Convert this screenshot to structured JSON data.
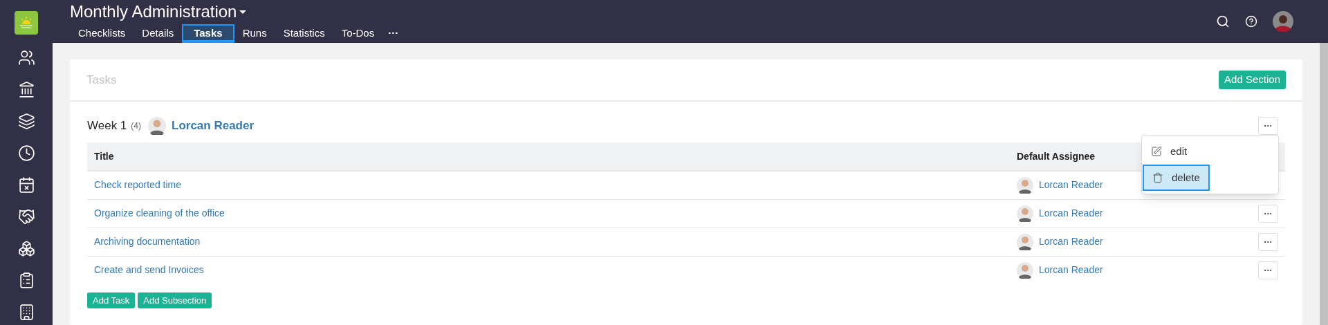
{
  "header": {
    "title": "Monthly Administration",
    "tabs": [
      {
        "label": "Checklists",
        "selected": false
      },
      {
        "label": "Details",
        "selected": false
      },
      {
        "label": "Tasks",
        "selected": true
      },
      {
        "label": "Runs",
        "selected": false
      },
      {
        "label": "Statistics",
        "selected": false
      },
      {
        "label": "To-Dos",
        "selected": false
      }
    ],
    "more": "···"
  },
  "panel": {
    "title": "Tasks",
    "add_section": "Add Section"
  },
  "section": {
    "name": "Week 1",
    "count": "(4)",
    "assignee": "Lorcan Reader",
    "menu_button": "···",
    "columns": [
      "Title",
      "Default Assignee"
    ],
    "rows": [
      {
        "title": "Check reported time",
        "assignee": "Lorcan Reader"
      },
      {
        "title": "Organize cleaning of the office",
        "assignee": "Lorcan Reader",
        "menu_button": "···"
      },
      {
        "title": "Archiving documentation",
        "assignee": "Lorcan Reader",
        "menu_button": "···"
      },
      {
        "title": "Create and send Invoices",
        "assignee": "Lorcan Reader",
        "menu_button": "···"
      }
    ],
    "buttons": [
      "Add Task",
      "Add Subsection"
    ]
  },
  "menu": [
    {
      "kind": "edit",
      "label": "edit",
      "selected": false
    },
    {
      "kind": "delete",
      "label": "delete",
      "selected": true
    }
  ]
}
